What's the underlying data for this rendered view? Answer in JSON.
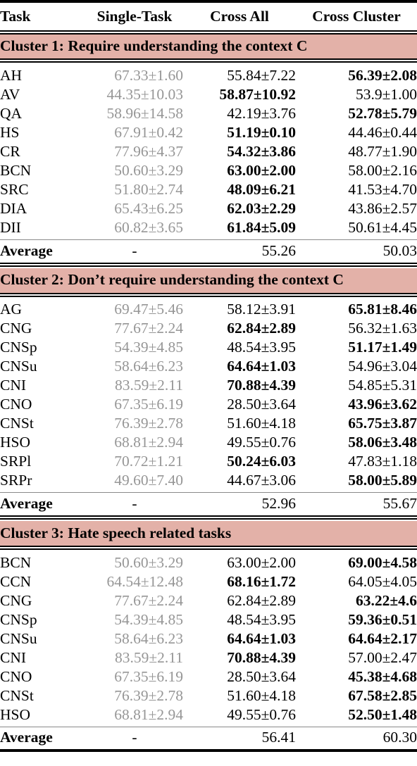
{
  "table": {
    "columns": [
      "Task",
      "Single-Task",
      "Cross All",
      "Cross Cluster"
    ],
    "banner_color": "#e3b1a8",
    "single_task_color": "#969696",
    "average_label": "Average",
    "average_single_placeholder": "-",
    "pm": "±",
    "sections": [
      {
        "banner": "Cluster 1: Require understanding the context C",
        "rows": [
          {
            "task": "AH",
            "single": "67.33±1.60",
            "cross_all": "55.84±7.22",
            "cross_cluster": "56.39±2.08",
            "bold_all": false,
            "bold_cluster": true
          },
          {
            "task": "AV",
            "single": "44.35±10.03",
            "cross_all": "58.87±10.92",
            "cross_cluster": "53.9±1.00",
            "bold_all": true,
            "bold_cluster": false
          },
          {
            "task": "QA",
            "single": "58.96±14.58",
            "cross_all": "42.19±3.76",
            "cross_cluster": "52.78±5.79",
            "bold_all": false,
            "bold_cluster": true
          },
          {
            "task": "HS",
            "single": "67.91±0.42",
            "cross_all": "51.19±0.10",
            "cross_cluster": "44.46±0.44",
            "bold_all": true,
            "bold_cluster": false
          },
          {
            "task": "CR",
            "single": "77.96±4.37",
            "cross_all": "54.32±3.86",
            "cross_cluster": "48.77±1.90",
            "bold_all": true,
            "bold_cluster": false
          },
          {
            "task": "BCN",
            "single": "50.60±3.29",
            "cross_all": "63.00±2.00",
            "cross_cluster": "58.00±2.16",
            "bold_all": true,
            "bold_cluster": false
          },
          {
            "task": "SRC",
            "single": "51.80±2.74",
            "cross_all": "48.09±6.21",
            "cross_cluster": "41.53±4.70",
            "bold_all": true,
            "bold_cluster": false
          },
          {
            "task": "DIA",
            "single": "65.43±6.25",
            "cross_all": "62.03±2.29",
            "cross_cluster": "43.86±2.57",
            "bold_all": true,
            "bold_cluster": false
          },
          {
            "task": "DII",
            "single": "60.82±3.65",
            "cross_all": "61.84±5.09",
            "cross_cluster": "50.61±4.45",
            "bold_all": true,
            "bold_cluster": false
          }
        ],
        "average": {
          "cross_all": "55.26",
          "cross_cluster": "50.03"
        }
      },
      {
        "banner": "Cluster 2: Don’t require understanding the context C",
        "rows": [
          {
            "task": "AG",
            "single": "69.47±5.46",
            "cross_all": "58.12±3.91",
            "cross_cluster": "65.81±8.46",
            "bold_all": false,
            "bold_cluster": true
          },
          {
            "task": "CNG",
            "single": "77.67±2.24",
            "cross_all": "62.84±2.89",
            "cross_cluster": "56.32±1.63",
            "bold_all": true,
            "bold_cluster": false
          },
          {
            "task": "CNSp",
            "single": "54.39±4.85",
            "cross_all": "48.54±3.95",
            "cross_cluster": "51.17±1.49",
            "bold_all": false,
            "bold_cluster": true
          },
          {
            "task": "CNSu",
            "single": "58.64±6.23",
            "cross_all": "64.64±1.03",
            "cross_cluster": "54.96±3.04",
            "bold_all": true,
            "bold_cluster": false
          },
          {
            "task": "CNI",
            "single": "83.59±2.11",
            "cross_all": "70.88±4.39",
            "cross_cluster": "54.85±5.31",
            "bold_all": true,
            "bold_cluster": false
          },
          {
            "task": "CNO",
            "single": "67.35±6.19",
            "cross_all": "28.50±3.64",
            "cross_cluster": "43.96±3.62",
            "bold_all": false,
            "bold_cluster": true
          },
          {
            "task": "CNSt",
            "single": "76.39±2.78",
            "cross_all": "51.60±4.18",
            "cross_cluster": "65.75±3.87",
            "bold_all": false,
            "bold_cluster": true
          },
          {
            "task": "HSO",
            "single": "68.81±2.94",
            "cross_all": "49.55±0.76",
            "cross_cluster": "58.06±3.48",
            "bold_all": false,
            "bold_cluster": true
          },
          {
            "task": "SRPl",
            "single": "70.72±1.21",
            "cross_all": "50.24±6.03",
            "cross_cluster": "47.83±1.18",
            "bold_all": true,
            "bold_cluster": false
          },
          {
            "task": "SRPr",
            "single": "49.60±7.40",
            "cross_all": "44.67±3.06",
            "cross_cluster": "58.00±5.89",
            "bold_all": false,
            "bold_cluster": true
          }
        ],
        "average": {
          "cross_all": "52.96",
          "cross_cluster": "55.67"
        }
      },
      {
        "banner": "Cluster 3: Hate speech related tasks",
        "rows": [
          {
            "task": "BCN",
            "single": "50.60±3.29",
            "cross_all": "63.00±2.00",
            "cross_cluster": "69.00±4.58",
            "bold_all": false,
            "bold_cluster": true
          },
          {
            "task": "CCN",
            "single": "64.54±12.48",
            "cross_all": "68.16±1.72",
            "cross_cluster": "64.05±4.05",
            "bold_all": true,
            "bold_cluster": false
          },
          {
            "task": "CNG",
            "single": "77.67±2.24",
            "cross_all": "62.84±2.89",
            "cross_cluster": "63.22±4.6",
            "bold_all": false,
            "bold_cluster": true
          },
          {
            "task": "CNSp",
            "single": "54.39±4.85",
            "cross_all": "48.54±3.95",
            "cross_cluster": "59.36±0.51",
            "bold_all": false,
            "bold_cluster": true
          },
          {
            "task": "CNSu",
            "single": "58.64±6.23",
            "cross_all": "64.64±1.03",
            "cross_cluster": "64.64±2.17",
            "bold_all": true,
            "bold_cluster": true
          },
          {
            "task": "CNI",
            "single": "83.59±2.11",
            "cross_all": "70.88±4.39",
            "cross_cluster": "57.00±2.47",
            "bold_all": true,
            "bold_cluster": false
          },
          {
            "task": "CNO",
            "single": "67.35±6.19",
            "cross_all": "28.50±3.64",
            "cross_cluster": "45.38±4.68",
            "bold_all": false,
            "bold_cluster": true
          },
          {
            "task": "CNSt",
            "single": "76.39±2.78",
            "cross_all": "51.60±4.18",
            "cross_cluster": "67.58±2.85",
            "bold_all": false,
            "bold_cluster": true
          },
          {
            "task": "HSO",
            "single": "68.81±2.94",
            "cross_all": "49.55±0.76",
            "cross_cluster": "52.50±1.48",
            "bold_all": false,
            "bold_cluster": true
          }
        ],
        "average": {
          "cross_all": "56.41",
          "cross_cluster": "60.30"
        }
      }
    ]
  }
}
